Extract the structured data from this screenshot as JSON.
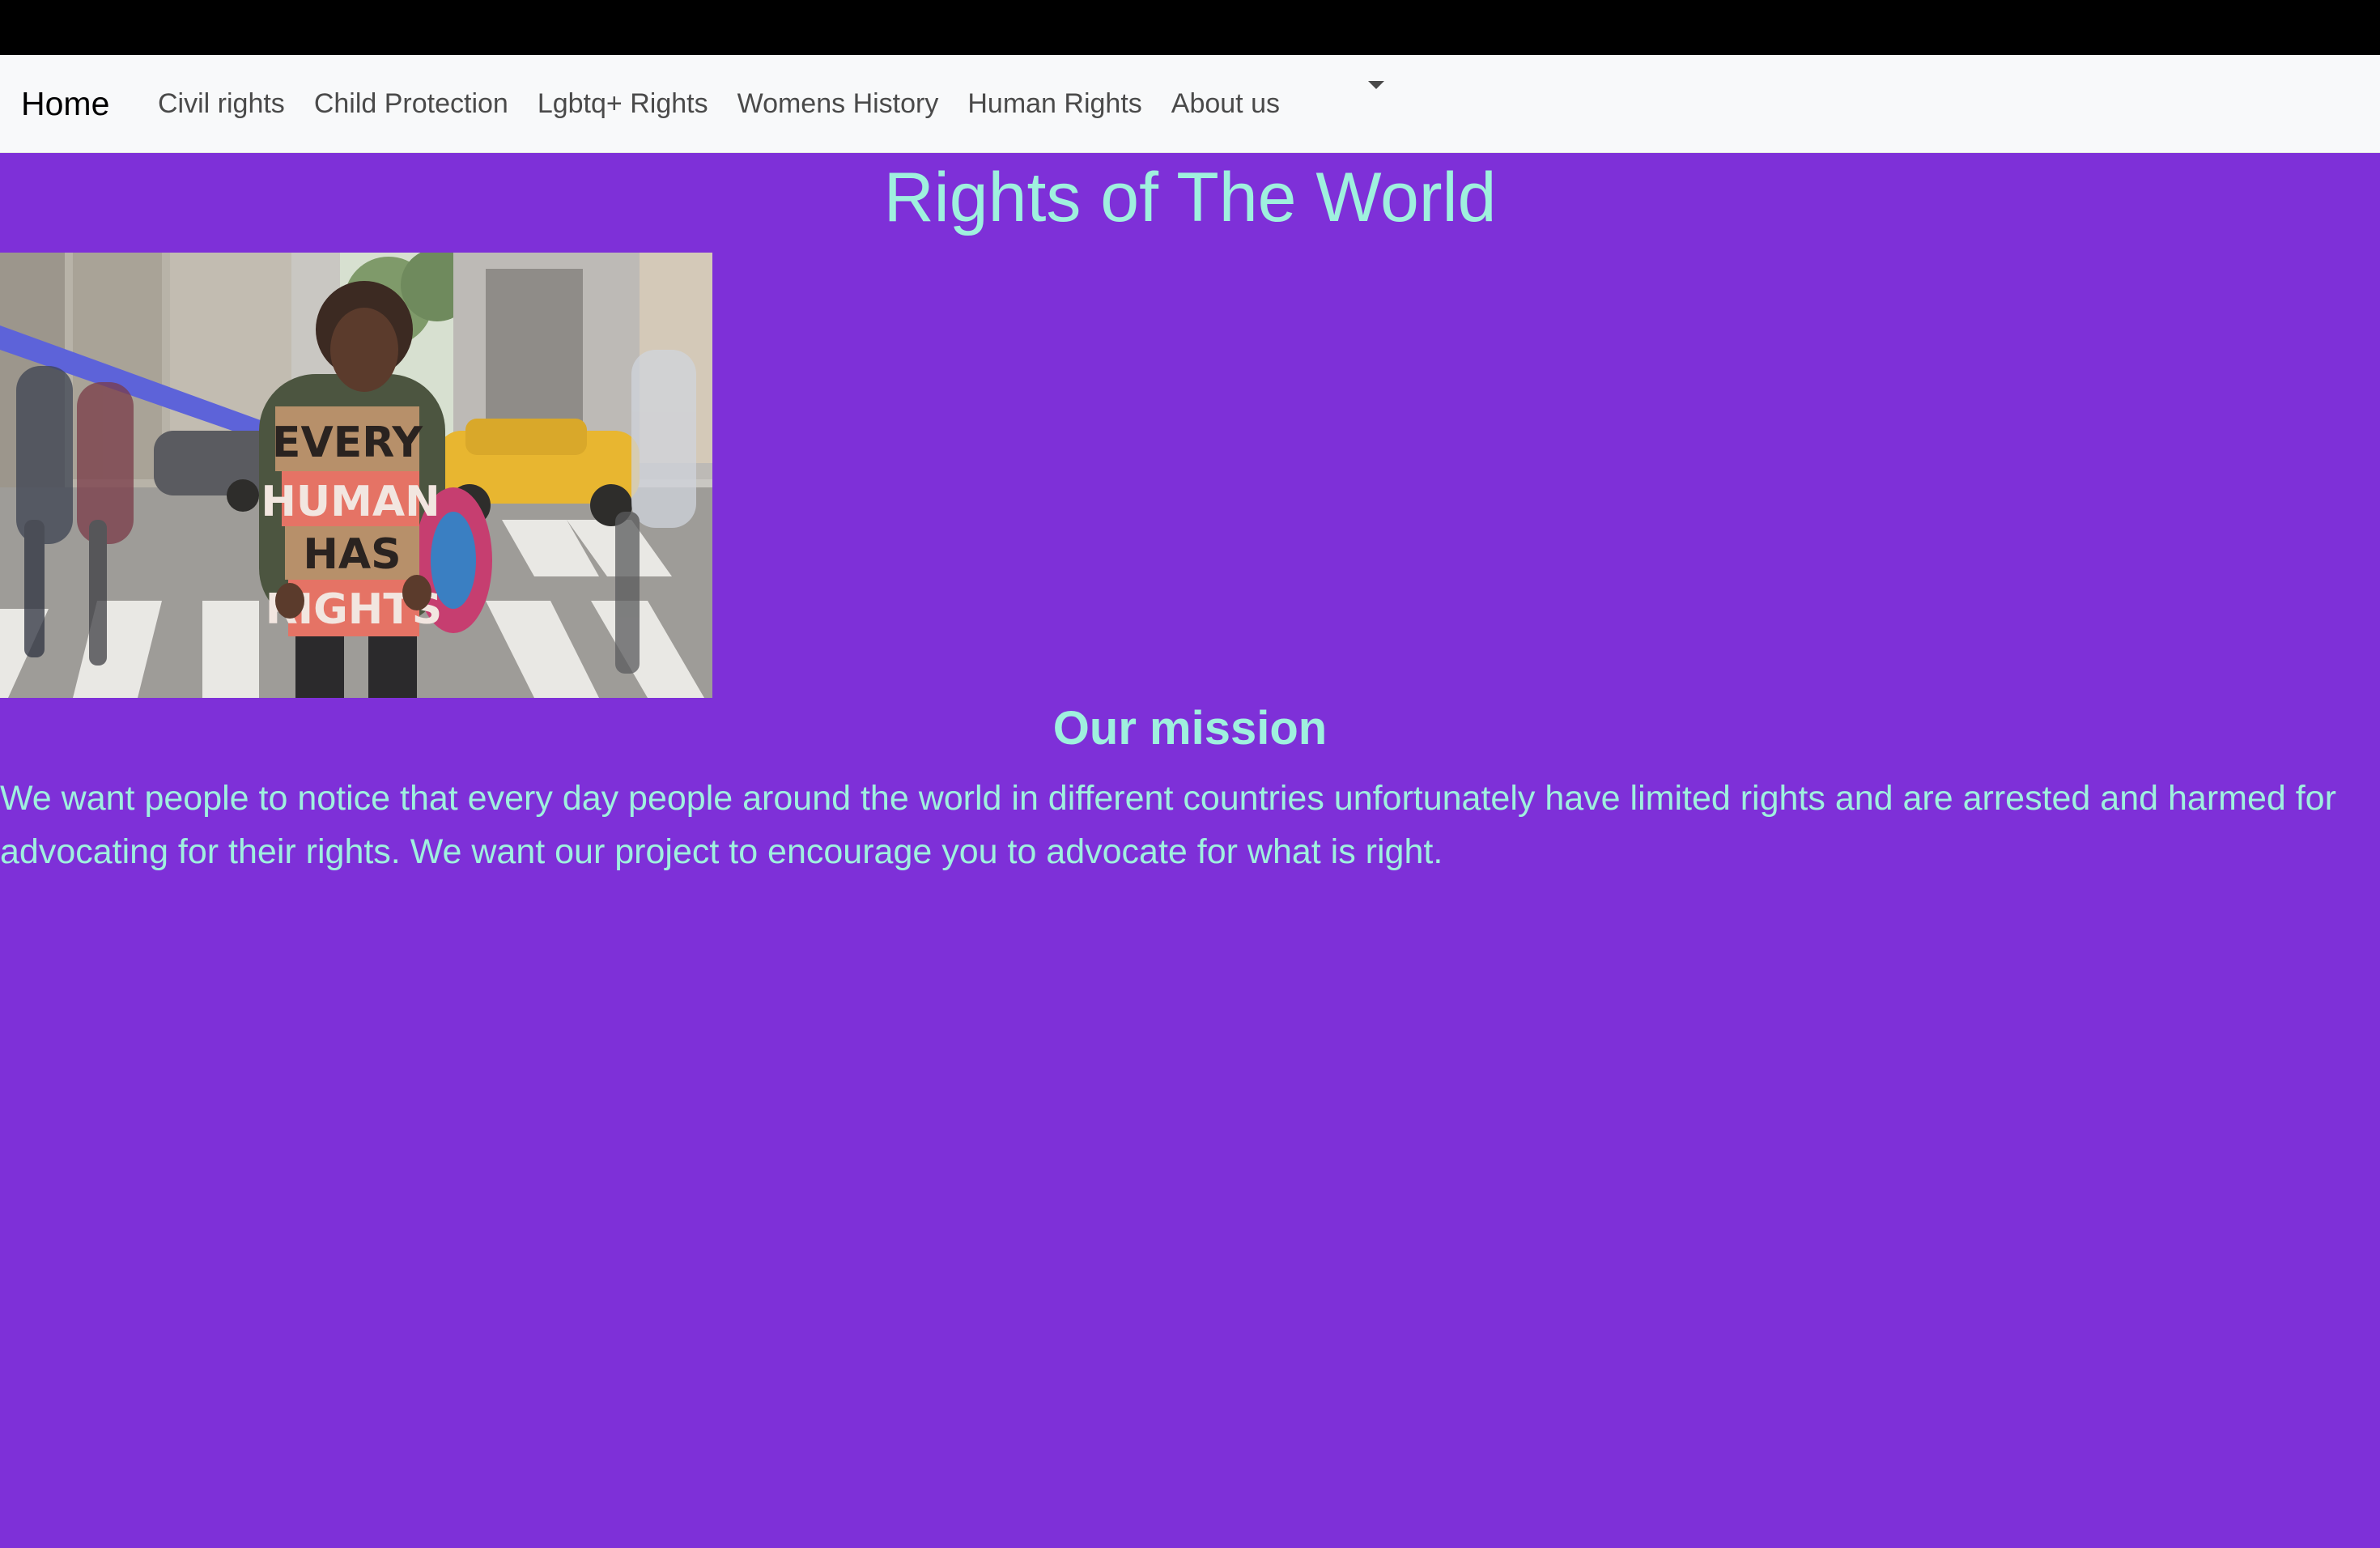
{
  "nav": {
    "brand": "Home",
    "links": [
      "Civil rights",
      "Child Protection",
      "Lgbtq+ Rights",
      "Womens History",
      "Human Rights",
      "About us"
    ]
  },
  "hero": {
    "title": "Rights of The World"
  },
  "photo": {
    "sign_lines": [
      "EVERY",
      "HUMAN",
      "HAS",
      "RIGHTS"
    ]
  },
  "mission": {
    "title": "Our mission",
    "text": "We want people to notice that every day people around the world in different countries unfortunately have limited rights and are arrested and harmed for advocating for their rights. We want our project to encourage you to advocate for what is right."
  },
  "colors": {
    "page_bg": "#7e30d8",
    "accent_text": "#9ff0de",
    "navbar_bg": "#f8f9fa"
  }
}
